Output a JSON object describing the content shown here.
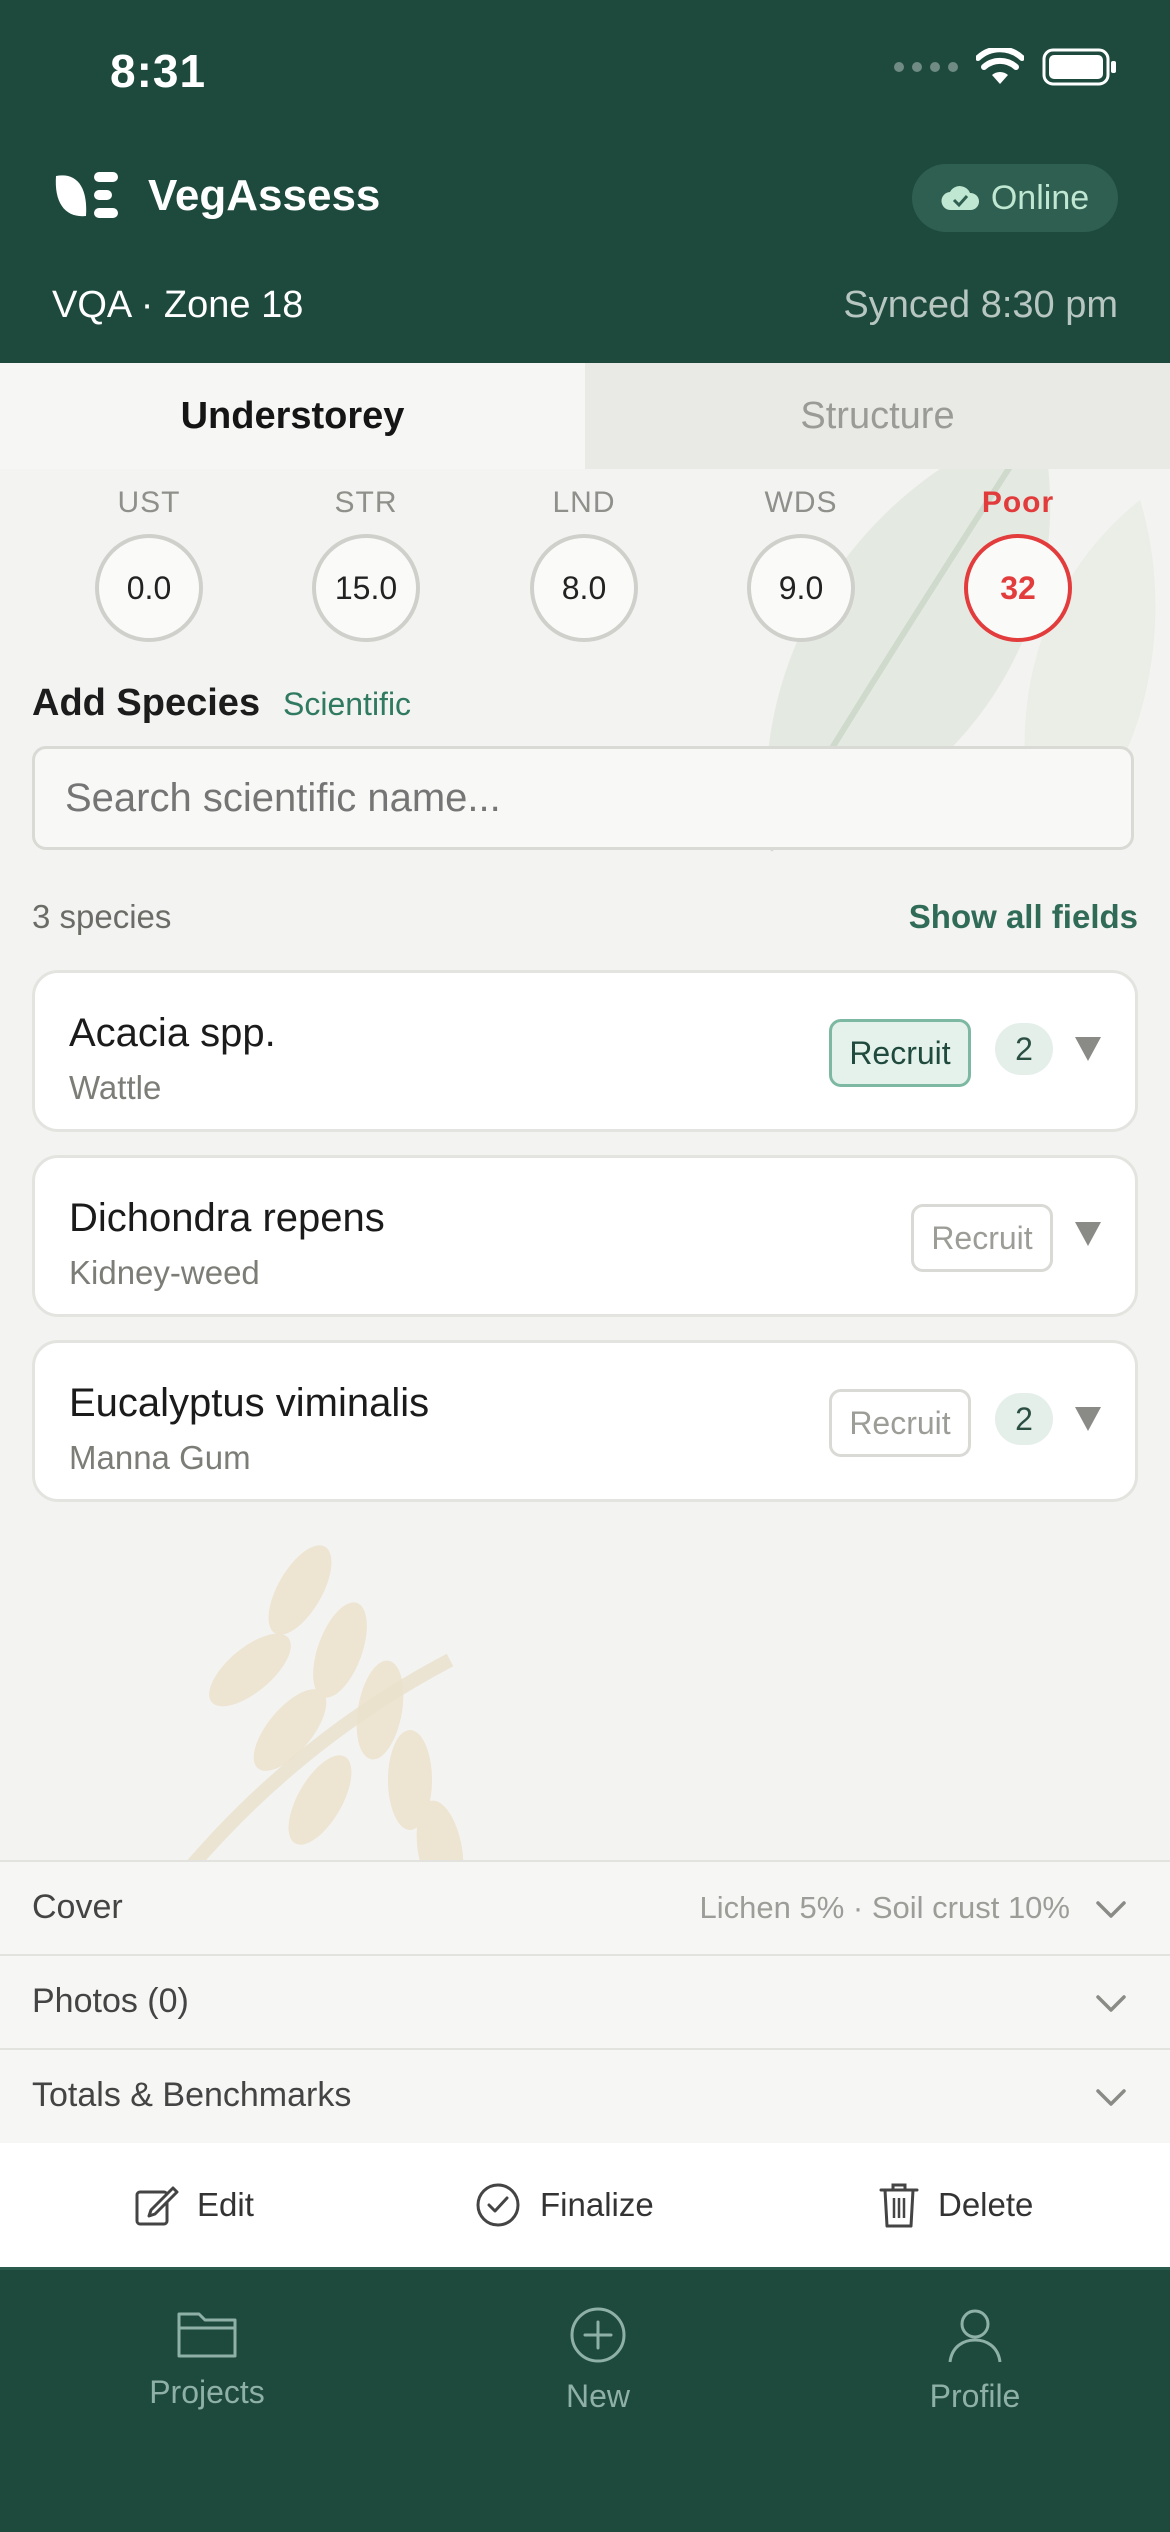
{
  "status_bar": {
    "time": "8:31"
  },
  "header": {
    "app_name": "VegAssess",
    "online_label": "Online",
    "project": "VQA · Zone 18",
    "synced": "Synced 8:30 pm"
  },
  "tabs": [
    {
      "label": "Understorey",
      "active": true
    },
    {
      "label": "Structure",
      "active": false
    }
  ],
  "scores": [
    {
      "label": "UST",
      "value": "0.0"
    },
    {
      "label": "STR",
      "value": "15.0"
    },
    {
      "label": "LND",
      "value": "8.0"
    },
    {
      "label": "WDS",
      "value": "9.0"
    },
    {
      "label": "Poor",
      "value": "32"
    }
  ],
  "add_species": {
    "title": "Add Species",
    "mode_link": "Scientific",
    "search_placeholder": "Search scientific name..."
  },
  "species_list": {
    "count_label": "3 species",
    "show_all": "Show all fields",
    "items": [
      {
        "name": "Acacia spp.",
        "common": "Wattle",
        "recruit": "Recruit",
        "recruit_selected": true,
        "count": "2"
      },
      {
        "name": "Dichondra repens",
        "common": "Kidney-weed",
        "recruit": "Recruit",
        "recruit_selected": false,
        "count": ""
      },
      {
        "name": "Eucalyptus viminalis",
        "common": "Manna Gum",
        "recruit": "Recruit",
        "recruit_selected": false,
        "count": "2"
      }
    ]
  },
  "accordions": [
    {
      "title": "Cover",
      "summary": "Lichen 5% · Soil crust 10%"
    },
    {
      "title": "Photos (0)",
      "summary": ""
    },
    {
      "title": "Totals & Benchmarks",
      "summary": ""
    }
  ],
  "actions": {
    "edit": "Edit",
    "finalize": "Finalize",
    "delete": "Delete"
  },
  "nav": {
    "projects": "Projects",
    "new": "New",
    "profile": "Profile"
  },
  "colors": {
    "primary": "#1d4a3d",
    "accent": "#2f7a60",
    "poor": "#e33c3c",
    "background": "#f3f3f1"
  }
}
